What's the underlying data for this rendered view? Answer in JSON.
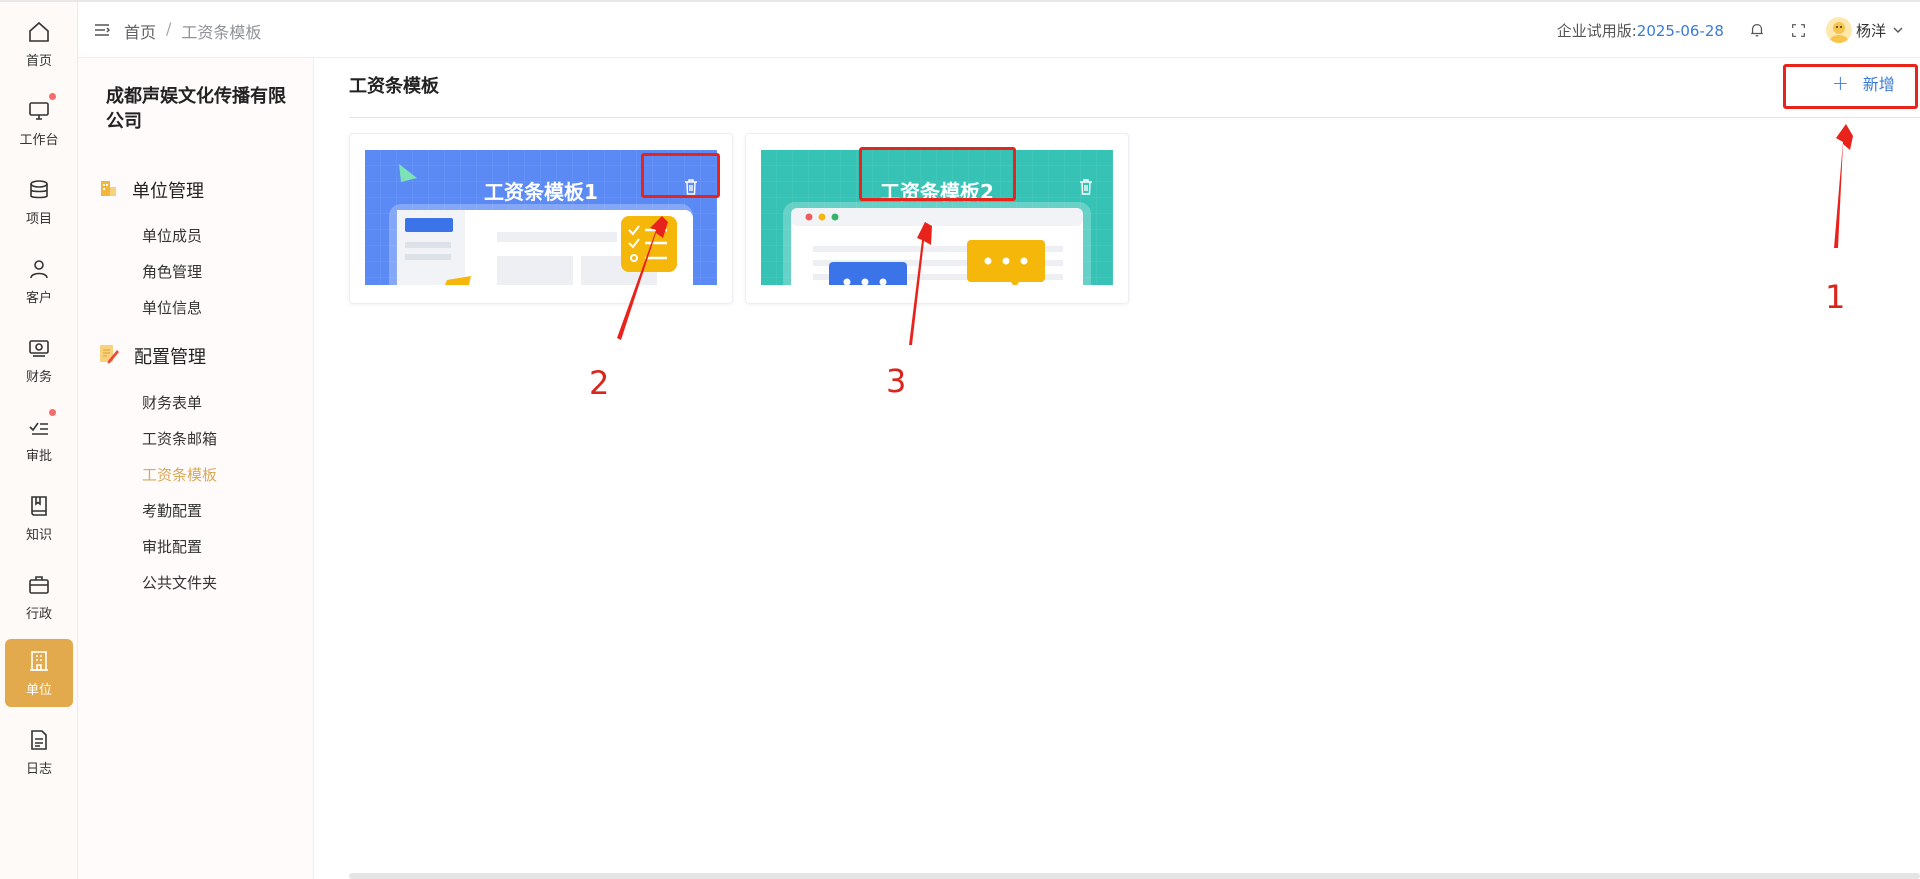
{
  "rail": [
    {
      "label": "首页",
      "icon": "home-icon"
    },
    {
      "label": "工作台",
      "icon": "monitor-icon",
      "badge": true
    },
    {
      "label": "项目",
      "icon": "database-icon"
    },
    {
      "label": "客户",
      "icon": "user-icon"
    },
    {
      "label": "财务",
      "icon": "money-icon"
    },
    {
      "label": "审批",
      "icon": "approval-icon",
      "badge": true
    },
    {
      "label": "知识",
      "icon": "book-icon"
    },
    {
      "label": "行政",
      "icon": "briefcase-icon"
    },
    {
      "label": "单位",
      "icon": "building-icon",
      "active": true
    },
    {
      "label": "日志",
      "icon": "document-icon"
    }
  ],
  "breadcrumb": {
    "home": "首页",
    "sep": "/",
    "current": "工资条模板"
  },
  "header": {
    "trial_label": "企业试用版:",
    "trial_date": "2025-06-28",
    "user_name": "杨洋"
  },
  "sidebar": {
    "company": "成都声娱文化传播有限公司",
    "groups": [
      {
        "label": "单位管理",
        "items": [
          "单位成员",
          "角色管理",
          "单位信息"
        ]
      },
      {
        "label": "配置管理",
        "items": [
          "财务表单",
          "工资条邮箱",
          "工资条模板",
          "考勤配置",
          "审批配置",
          "公共文件夹"
        ]
      }
    ],
    "active_item": "工资条模板"
  },
  "main": {
    "title": "工资条模板",
    "add_label": "新增",
    "templates": [
      {
        "name": "工资条模板1",
        "color": "#5b8af5"
      },
      {
        "name": "工资条模板2",
        "color": "#36c2b4"
      }
    ]
  },
  "annotations": {
    "labels": [
      "1",
      "2",
      "3"
    ],
    "color": "#e8231c"
  }
}
